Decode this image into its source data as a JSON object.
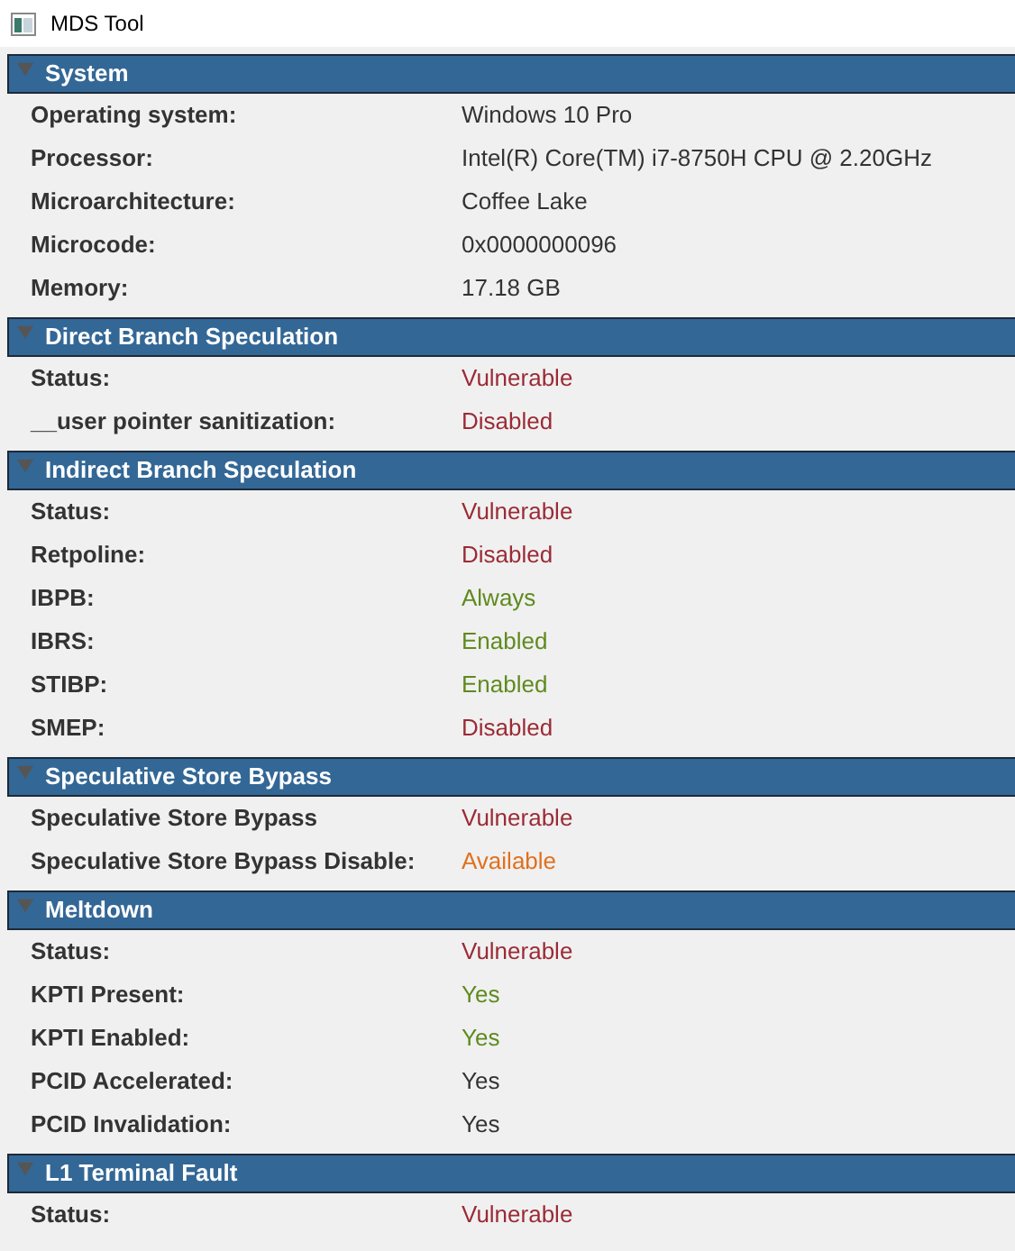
{
  "window": {
    "title": "MDS Tool"
  },
  "sections": [
    {
      "title": "System",
      "expanded": true,
      "rows": [
        {
          "label": "Operating system:",
          "value": "Windows 10 Pro",
          "color": "#333333"
        },
        {
          "label": "Processor:",
          "value": "Intel(R) Core(TM) i7-8750H CPU @ 2.20GHz",
          "color": "#333333"
        },
        {
          "label": "Microarchitecture:",
          "value": "Coffee Lake",
          "color": "#333333"
        },
        {
          "label": "Microcode:",
          "value": "0x0000000096",
          "color": "#333333"
        },
        {
          "label": "Memory:",
          "value": "17.18 GB",
          "color": "#333333"
        }
      ]
    },
    {
      "title": "Direct Branch Speculation",
      "expanded": true,
      "rows": [
        {
          "label": "Status:",
          "value": "Vulnerable",
          "color": "#9b2a35"
        },
        {
          "label": "__user pointer sanitization:",
          "value": "Disabled",
          "color": "#9b2a35"
        }
      ]
    },
    {
      "title": "Indirect Branch Speculation",
      "expanded": true,
      "rows": [
        {
          "label": "Status:",
          "value": "Vulnerable",
          "color": "#9b2a35"
        },
        {
          "label": "Retpoline:",
          "value": "Disabled",
          "color": "#9b2a35"
        },
        {
          "label": "IBPB:",
          "value": "Always",
          "color": "#5f8a1e"
        },
        {
          "label": "IBRS:",
          "value": "Enabled",
          "color": "#5f8a1e"
        },
        {
          "label": "STIBP:",
          "value": "Enabled",
          "color": "#5f8a1e"
        },
        {
          "label": "SMEP:",
          "value": "Disabled",
          "color": "#9b2a35"
        }
      ]
    },
    {
      "title": "Speculative Store Bypass",
      "expanded": true,
      "rows": [
        {
          "label": "Speculative Store Bypass",
          "value": "Vulnerable",
          "color": "#9b2a35"
        },
        {
          "label": "Speculative Store Bypass Disable:",
          "value": "Available",
          "color": "#e0701e"
        }
      ]
    },
    {
      "title": "Meltdown",
      "expanded": true,
      "rows": [
        {
          "label": "Status:",
          "value": "Vulnerable",
          "color": "#9b2a35"
        },
        {
          "label": "KPTI Present:",
          "value": "Yes",
          "color": "#5f8a1e"
        },
        {
          "label": "KPTI Enabled:",
          "value": "Yes",
          "color": "#5f8a1e"
        },
        {
          "label": "PCID Accelerated:",
          "value": "Yes",
          "color": "#333333"
        },
        {
          "label": "PCID Invalidation:",
          "value": "Yes",
          "color": "#333333"
        }
      ]
    },
    {
      "title": "L1 Terminal Fault",
      "expanded": true,
      "rows": [
        {
          "label": "Status:",
          "value": "Vulnerable",
          "color": "#9b2a35"
        }
      ]
    }
  ]
}
